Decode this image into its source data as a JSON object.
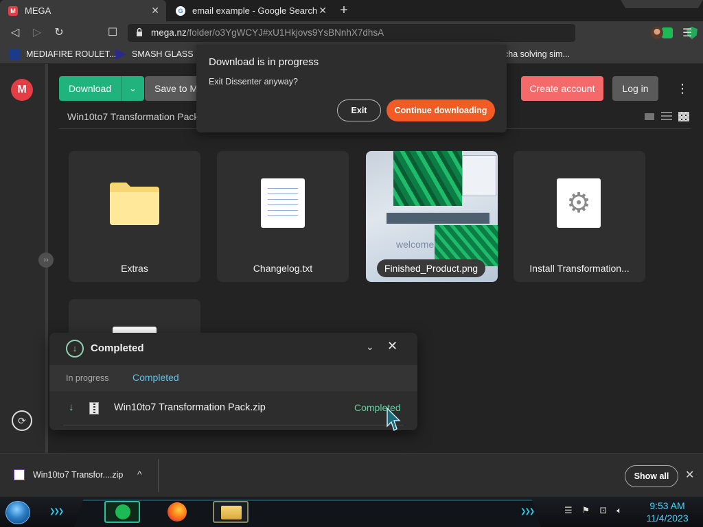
{
  "tabs": [
    {
      "favicon": "M",
      "title": "MEGA",
      "close": "✕"
    },
    {
      "favicon": "G",
      "title": "email example - Google Search",
      "close": "✕"
    }
  ],
  "new_tab_label": "+",
  "toolbar": {
    "back": "◁",
    "forward": "▷",
    "reload": "↻",
    "bookmark": "☐",
    "url_host": "mega.nz",
    "url_path": "/folder/o3YgWCYJ#xU1Hkjovs9YsBNnhX7dhsA",
    "menu": "☰"
  },
  "bookmarks": [
    {
      "label": "MEDIAFIRE ROULET...",
      "icon": "mediafire-icon"
    },
    {
      "label": "SMASH GLASS IN",
      "icon": "glass-icon"
    },
    {
      "label": "cha solving sim...",
      "icon": ""
    }
  ],
  "mega": {
    "logo": "M",
    "download_label": "Download",
    "download_caret": "⌄",
    "save_label": "Save to M",
    "breadcrumb": "Win10to7 Transformation Pack",
    "create_account": "Create account",
    "login": "Log in",
    "more": "⋮",
    "handle": "››",
    "sync": "⟳"
  },
  "files": [
    {
      "name": "Extras",
      "type": "folder"
    },
    {
      "name": "Changelog.txt",
      "type": "text"
    },
    {
      "name": "Finished_Product.png",
      "type": "image",
      "thumb_text": "welcome"
    },
    {
      "name": "Install Transformation...",
      "type": "exe"
    }
  ],
  "dialog": {
    "title": "Download is in progress",
    "message": "Exit Dissenter anyway?",
    "exit_label": "Exit",
    "continue_label": "Continue downloading"
  },
  "transfers": {
    "title": "Completed",
    "ok_glyph": "↓",
    "collapse": "⌄",
    "close": "✕",
    "tab_in_progress": "In progress",
    "tab_completed": "Completed",
    "item": {
      "arrow": "↓",
      "name": "Win10to7 Transformation Pack.zip",
      "status": "Completed"
    }
  },
  "shelf": {
    "item_name": "Win10to7 Transfor....zip",
    "caret": "^",
    "show_all": "Show all",
    "close": "✕"
  },
  "taskbar": {
    "clock_time": "9:53 AM",
    "clock_date": "11/4/2023",
    "chevrons": "❯❯❯"
  },
  "colors": {
    "mega_red": "#e53d45",
    "download_green": "#21b37e",
    "continue_orange": "#f25a26",
    "completed_blue": "#62c0e6"
  }
}
